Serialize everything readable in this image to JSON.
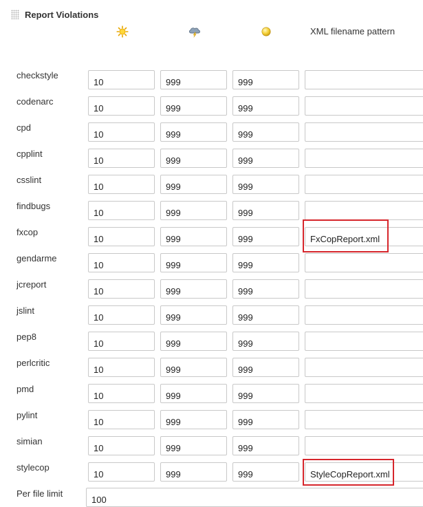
{
  "section": {
    "title": "Report Violations",
    "grip_icon": "drag-grip-icon"
  },
  "columns": {
    "sunny_icon": "sun-icon",
    "stormy_icon": "storm-cloud-icon",
    "unstable_icon": "yellow-ball-icon",
    "pattern_header": "XML filename pattern"
  },
  "rows": [
    {
      "name": "checkstyle",
      "sunny": "10",
      "stormy": "999",
      "unstable": "999",
      "pattern": ""
    },
    {
      "name": "codenarc",
      "sunny": "10",
      "stormy": "999",
      "unstable": "999",
      "pattern": ""
    },
    {
      "name": "cpd",
      "sunny": "10",
      "stormy": "999",
      "unstable": "999",
      "pattern": ""
    },
    {
      "name": "cpplint",
      "sunny": "10",
      "stormy": "999",
      "unstable": "999",
      "pattern": ""
    },
    {
      "name": "csslint",
      "sunny": "10",
      "stormy": "999",
      "unstable": "999",
      "pattern": ""
    },
    {
      "name": "findbugs",
      "sunny": "10",
      "stormy": "999",
      "unstable": "999",
      "pattern": ""
    },
    {
      "name": "fxcop",
      "sunny": "10",
      "stormy": "999",
      "unstable": "999",
      "pattern": "FxCopReport.xml"
    },
    {
      "name": "gendarme",
      "sunny": "10",
      "stormy": "999",
      "unstable": "999",
      "pattern": ""
    },
    {
      "name": "jcreport",
      "sunny": "10",
      "stormy": "999",
      "unstable": "999",
      "pattern": ""
    },
    {
      "name": "jslint",
      "sunny": "10",
      "stormy": "999",
      "unstable": "999",
      "pattern": ""
    },
    {
      "name": "pep8",
      "sunny": "10",
      "stormy": "999",
      "unstable": "999",
      "pattern": ""
    },
    {
      "name": "perlcritic",
      "sunny": "10",
      "stormy": "999",
      "unstable": "999",
      "pattern": ""
    },
    {
      "name": "pmd",
      "sunny": "10",
      "stormy": "999",
      "unstable": "999",
      "pattern": ""
    },
    {
      "name": "pylint",
      "sunny": "10",
      "stormy": "999",
      "unstable": "999",
      "pattern": ""
    },
    {
      "name": "simian",
      "sunny": "10",
      "stormy": "999",
      "unstable": "999",
      "pattern": ""
    },
    {
      "name": "stylecop",
      "sunny": "10",
      "stormy": "999",
      "unstable": "999",
      "pattern": "StyleCopReport.xml"
    }
  ],
  "per_file_limit": {
    "label": "Per file limit",
    "value": "100"
  },
  "colors": {
    "highlight": "#d6252b",
    "input_border": "#c8c8c8",
    "text": "#333333"
  }
}
